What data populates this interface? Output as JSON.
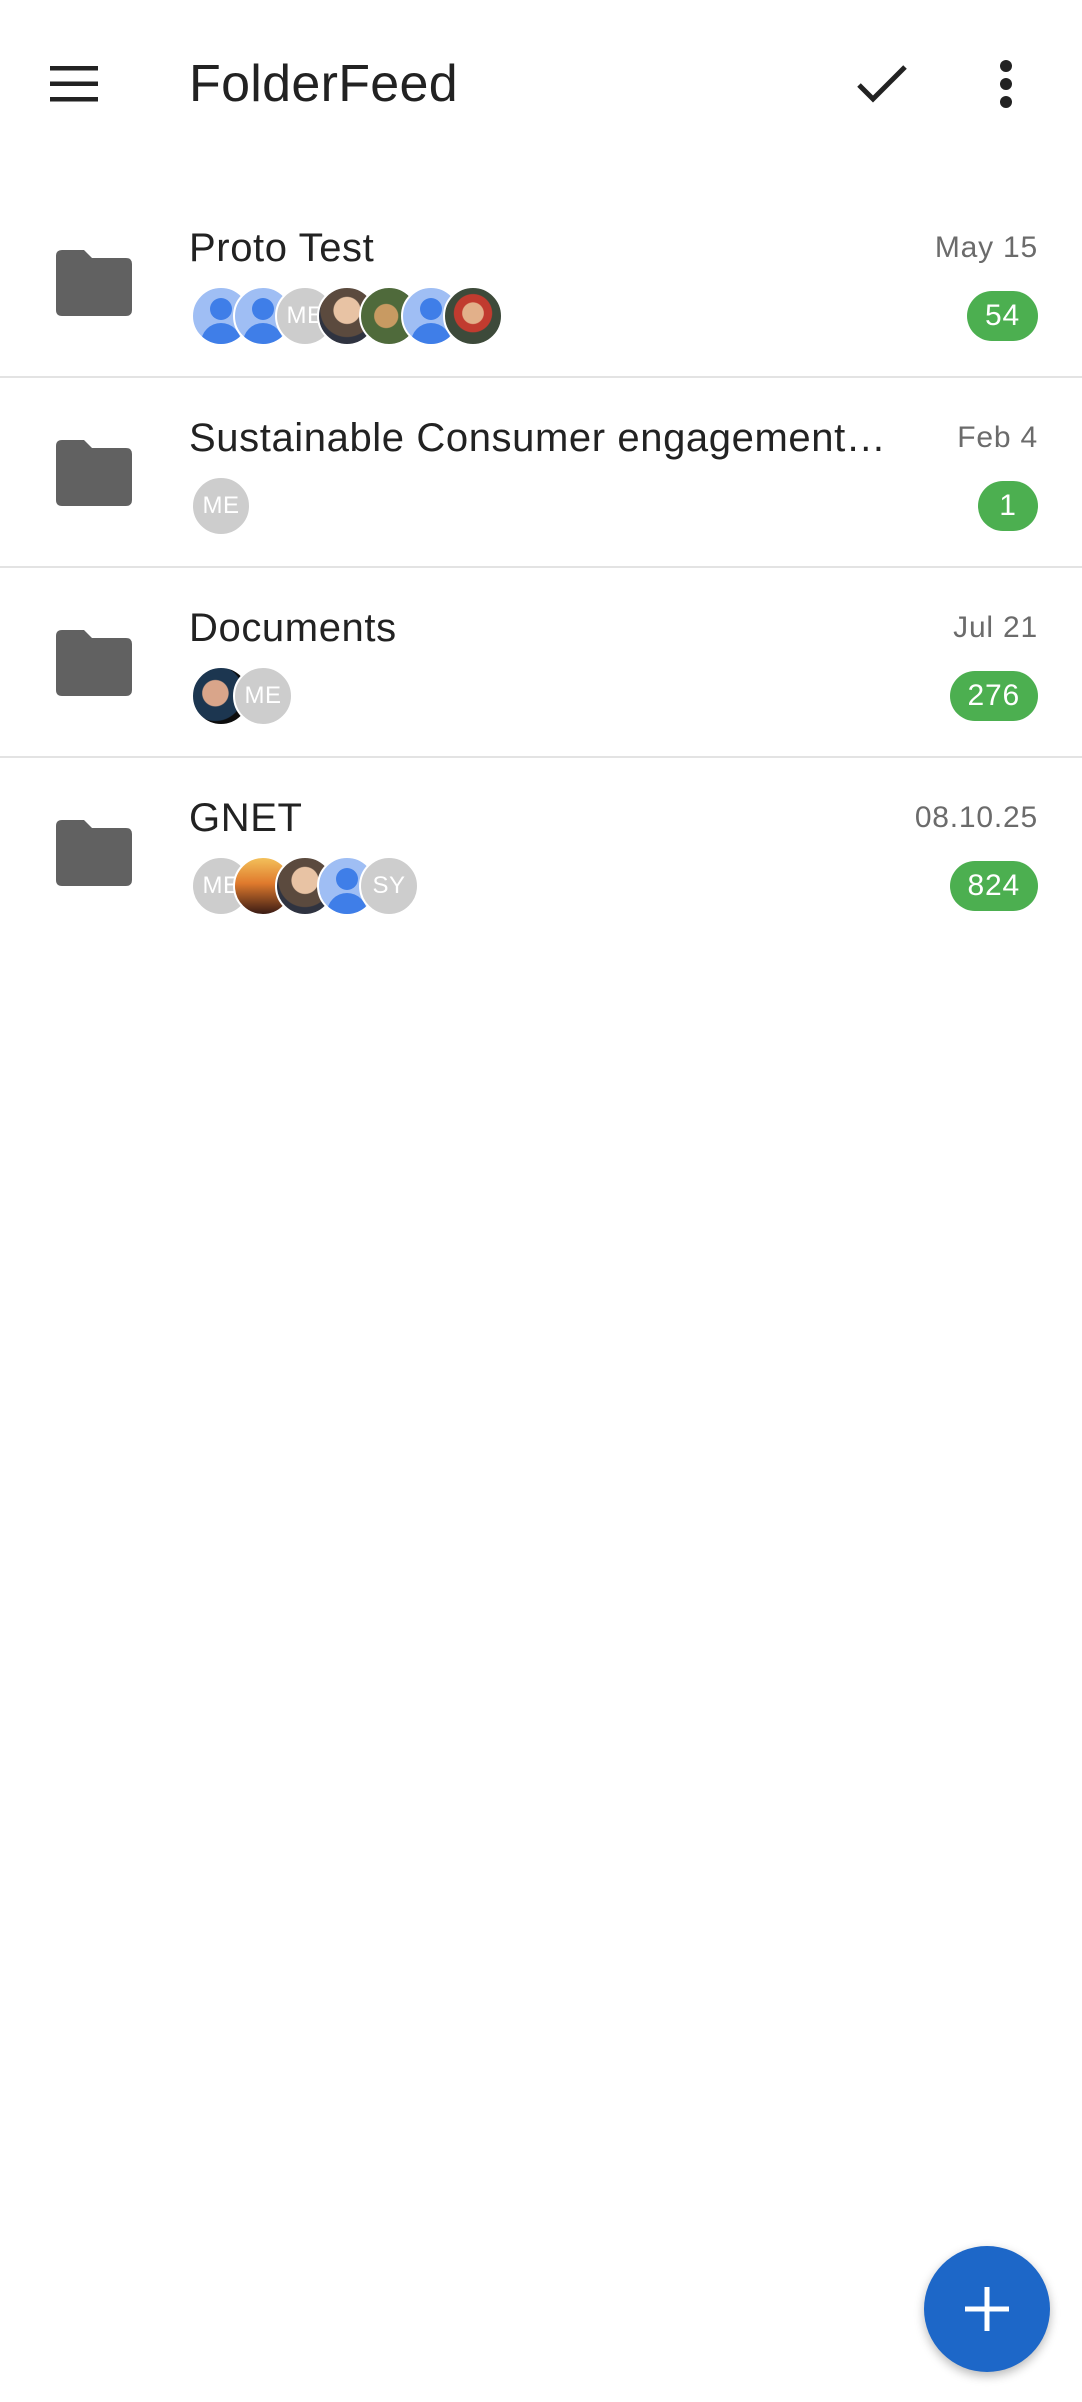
{
  "app": {
    "title": "FolderFeed"
  },
  "icons": {
    "menu": "menu-icon",
    "check": "check-icon",
    "more": "more-vert-icon",
    "folder": "folder-icon",
    "add": "add-icon"
  },
  "colors": {
    "badge": "#4caf50",
    "fab": "#1d67c8",
    "folder_icon": "#616161"
  },
  "folders": [
    {
      "name": "Proto Test",
      "date": "May 15",
      "count": "54",
      "avatars": [
        {
          "type": "generic"
        },
        {
          "type": "generic"
        },
        {
          "type": "initials",
          "text": "ME"
        },
        {
          "type": "photo"
        },
        {
          "type": "photo"
        },
        {
          "type": "generic"
        },
        {
          "type": "photo"
        }
      ]
    },
    {
      "name": "Sustainable Consumer engagement…",
      "date": "Feb 4",
      "count": "1",
      "avatars": [
        {
          "type": "initials",
          "text": "ME"
        }
      ]
    },
    {
      "name": "Documents",
      "date": "Jul 21",
      "count": "276",
      "avatars": [
        {
          "type": "photo"
        },
        {
          "type": "initials",
          "text": "ME"
        }
      ]
    },
    {
      "name": "GNET",
      "date": "08.10.25",
      "count": "824",
      "avatars": [
        {
          "type": "initials",
          "text": "ME"
        },
        {
          "type": "photo"
        },
        {
          "type": "photo"
        },
        {
          "type": "generic"
        },
        {
          "type": "initials",
          "text": "SY"
        }
      ]
    }
  ]
}
